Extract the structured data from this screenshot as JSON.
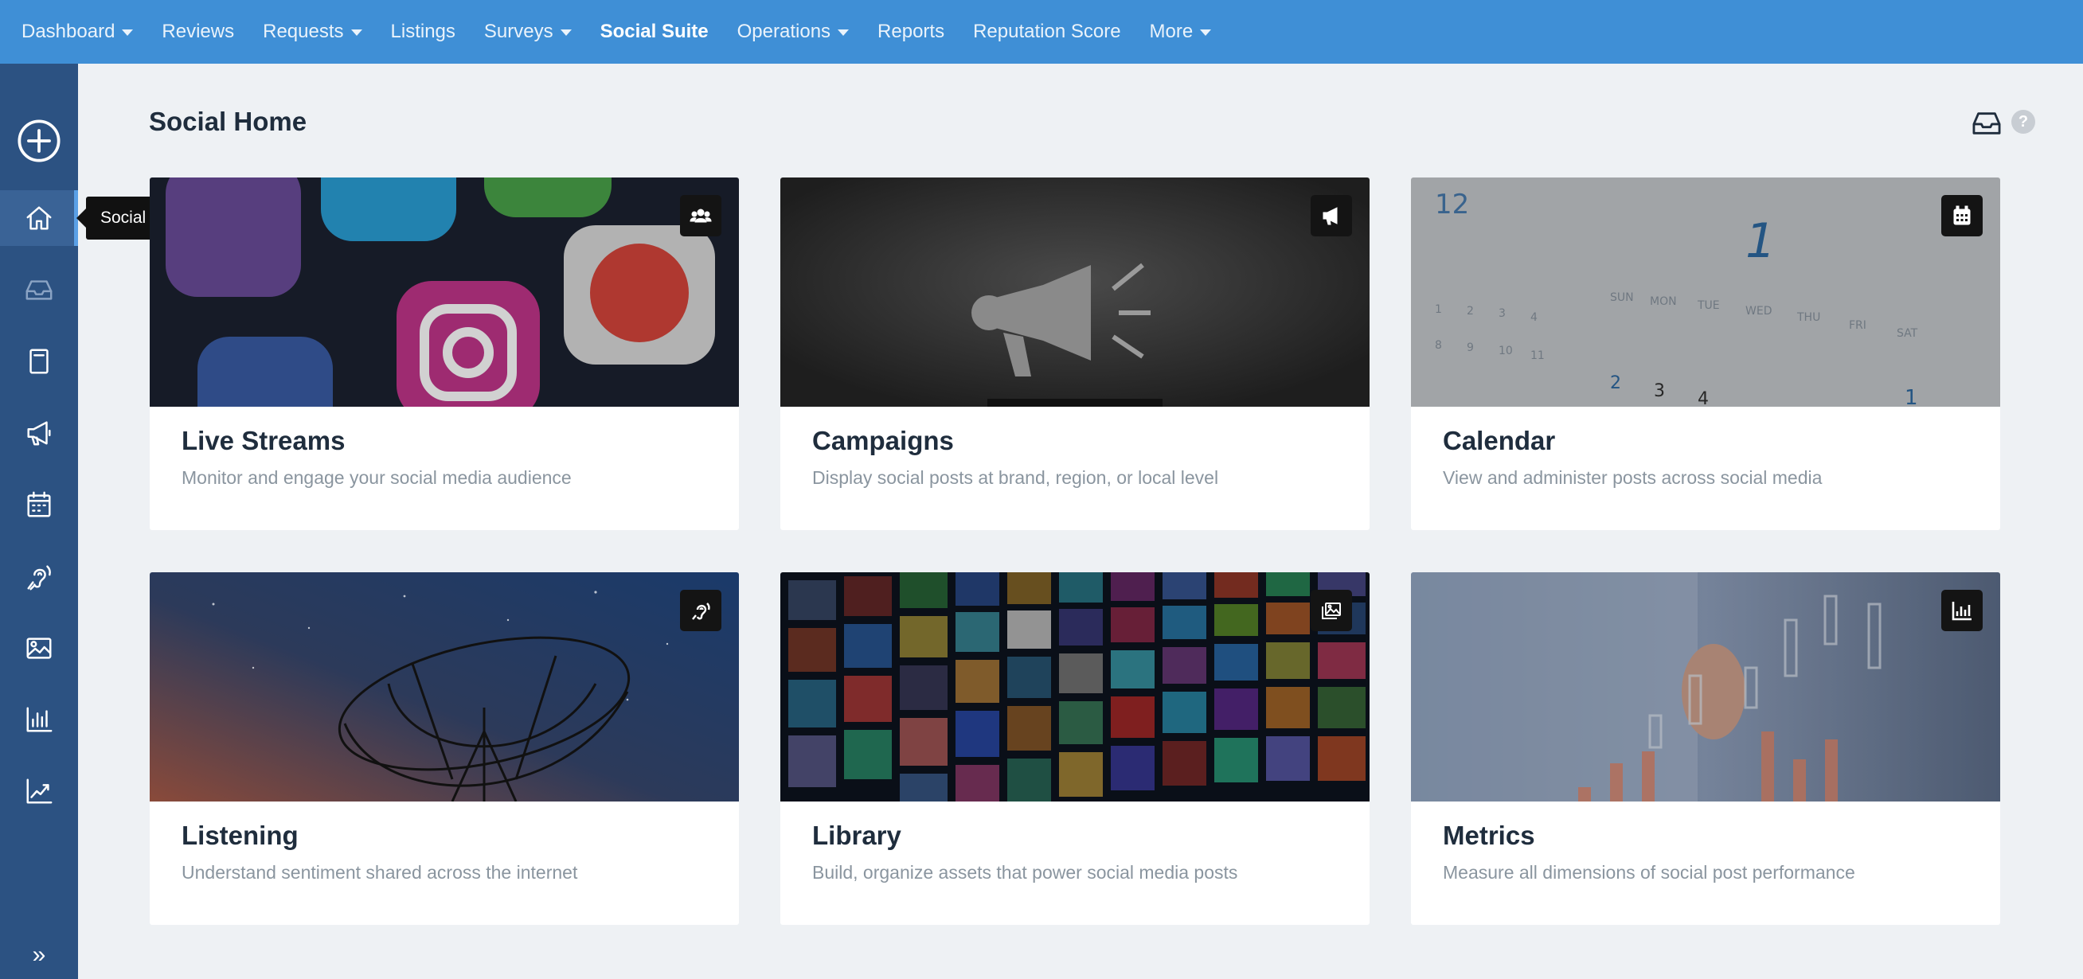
{
  "topnav": {
    "items": [
      {
        "label": "Dashboard",
        "dropdown": true
      },
      {
        "label": "Reviews",
        "dropdown": false
      },
      {
        "label": "Requests",
        "dropdown": true
      },
      {
        "label": "Listings",
        "dropdown": false
      },
      {
        "label": "Surveys",
        "dropdown": true
      },
      {
        "label": "Social Suite",
        "dropdown": false,
        "active": true
      },
      {
        "label": "Operations",
        "dropdown": true
      },
      {
        "label": "Reports",
        "dropdown": false
      },
      {
        "label": "Reputation Score",
        "dropdown": false
      },
      {
        "label": "More",
        "dropdown": true
      }
    ]
  },
  "sidebar": {
    "tooltip": "Social home",
    "icons": [
      "add-icon",
      "home-icon",
      "inbox-icon",
      "book-icon",
      "megaphone-icon",
      "calendar-icon",
      "listening-ear-icon",
      "image-icon",
      "bar-chart-icon",
      "trend-chart-icon",
      "expand-chevrons-icon"
    ]
  },
  "page": {
    "title": "Social Home"
  },
  "cards": [
    {
      "title": "Live Streams",
      "description": "Monitor and engage your social media audience",
      "icon": "users-icon"
    },
    {
      "title": "Campaigns",
      "description": "Display social posts at brand, region, or local level",
      "icon": "megaphone-icon"
    },
    {
      "title": "Calendar",
      "description": "View and administer posts across social media",
      "icon": "calendar-icon"
    },
    {
      "title": "Listening",
      "description": "Understand sentiment shared across the internet",
      "icon": "listening-ear-icon"
    },
    {
      "title": "Library",
      "description": "Build, organize assets that power social media posts",
      "icon": "images-icon"
    },
    {
      "title": "Metrics",
      "description": "Measure all dimensions of social post performance",
      "icon": "bar-chart-icon"
    }
  ],
  "colors": {
    "topnav": "#3f8fd6",
    "sidebar": "#2c5282",
    "background": "#eef1f4"
  }
}
